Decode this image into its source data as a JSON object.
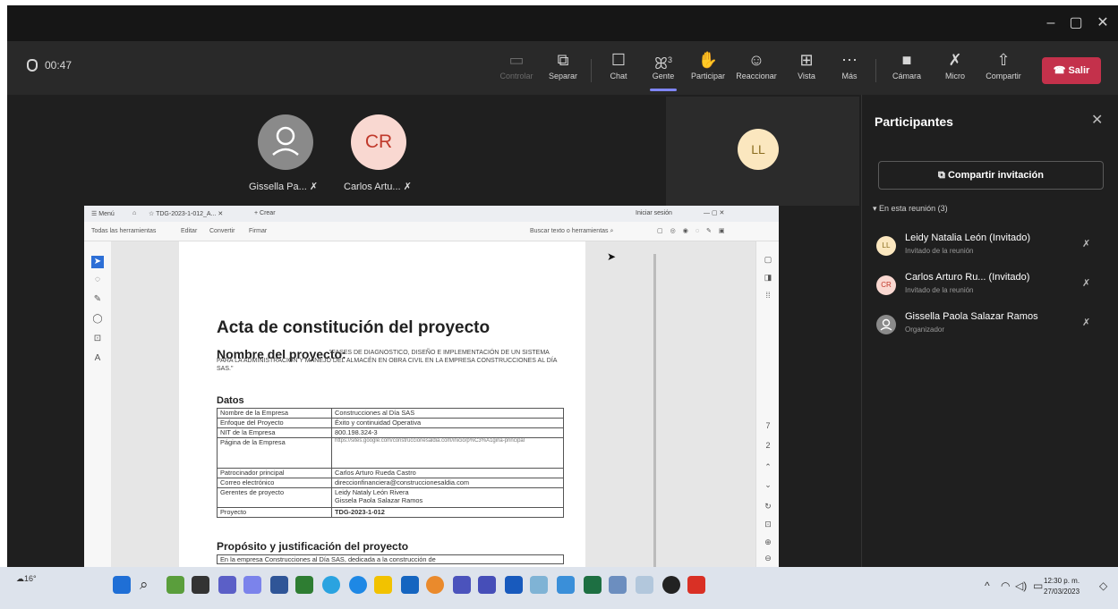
{
  "toolbar": {
    "timer": "00:47",
    "buttons": [
      {
        "label": "Controlar",
        "icon": "control-icon"
      },
      {
        "label": "Separar",
        "icon": "pop-out-icon"
      },
      {
        "label": "Chat",
        "icon": "chat-icon"
      },
      {
        "label": "Gente",
        "icon": "people-icon",
        "badge": "3"
      },
      {
        "label": "Participar",
        "icon": "raise-hand-icon"
      },
      {
        "label": "Reaccionar",
        "icon": "smile-icon"
      },
      {
        "label": "Vista",
        "icon": "view-icon"
      },
      {
        "label": "Más",
        "icon": "more-icon"
      },
      {
        "label": "Cámara",
        "icon": "camera-off-icon"
      },
      {
        "label": "Micro",
        "icon": "mic-off-icon"
      },
      {
        "label": "Compartir",
        "icon": "share-icon"
      }
    ],
    "leave_label": "Salir"
  },
  "stage": {
    "tiles": [
      {
        "initials": "",
        "name": "Gissella Pa..."
      },
      {
        "initials": "CR",
        "name": "Carlos Artu..."
      },
      {
        "initials": "LL",
        "name": ""
      }
    ]
  },
  "pdf": {
    "tabs": {
      "menu": "Menú",
      "doc_tab": "TDG-2023-1-012_A...",
      "new_tab": "+ Crear",
      "signin": "Iniciar sesión"
    },
    "menu": {
      "all_tools": "Todas las herramientas",
      "edit": "Editar",
      "convert": "Convertir",
      "sign": "Firmar",
      "search": "Buscar texto o herramientas"
    },
    "title": "Acta de constitución del proyecto",
    "project_label": "Nombre del proyecto:",
    "project_text": "\"FASES DE DIAGNOSTICO, DISEÑO E IMPLEMENTACIÓN DE UN SISTEMA PARA LA ADMINISTRACIÓN Y MANEJO DEL ALMACÉN EN OBRA CIVIL EN LA EMPRESA CONSTRUCCIONES AL DÍA SAS.\"",
    "datos_heading": "Datos",
    "rows": [
      {
        "key": "Nombre de la Empresa",
        "value": "Construcciones al Día SAS"
      },
      {
        "key": "Enfoque del Proyecto",
        "value": "Éxito y continuidad Operativa"
      },
      {
        "key": "NIT de la Empresa",
        "value": "800.198.324-3"
      },
      {
        "key": "Página de la Empresa",
        "value": "https://sites.google.com/construccionesaldia.com/inicio/p%C3%A1gina-principal"
      },
      {
        "key": "Patrocinador principal",
        "value": "Carlos Arturo Rueda Castro"
      },
      {
        "key": "Correo electrónico",
        "value": "direccionfinanciera@construccionesaldia.com"
      },
      {
        "key": "Gerentes de proyecto",
        "value": "Leidy Nataly León Rivera",
        "value2": "Gissela Paola Salazar Ramos"
      },
      {
        "key": "Proyecto",
        "value": "TDG-2023-1-012"
      }
    ],
    "purpose_heading": "Propósito y justificación del proyecto",
    "purpose_text": "En la empresa Construcciones al Día SAS, dedicada a la construcción de"
  },
  "panel": {
    "title": "Participantes",
    "invite_label": "Compartir invitación",
    "section_label": "En esta reunión (3)",
    "people": [
      {
        "initials": "LL",
        "name": "Leidy Natalia León (Invitado)",
        "role": "Invitado de la reunión"
      },
      {
        "initials": "CR",
        "name": "Carlos Arturo Ru... (Invitado)",
        "role": "Invitado de la reunión"
      },
      {
        "initials": "",
        "name": "Gissella Paola Salazar Ramos",
        "role": "Organizador"
      }
    ]
  },
  "taskbar": {
    "weather": "16°",
    "time": "12:30 p. m.",
    "date": "27/03/2023"
  },
  "colors": {
    "accent": "#7f85f5",
    "leave": "#c4314b",
    "cr_avatar": "#f9d8d1",
    "ll_avatar": "#fbe7bf"
  }
}
